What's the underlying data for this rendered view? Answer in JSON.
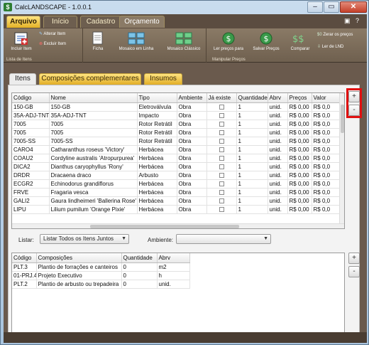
{
  "window": {
    "title": "CalcLANDSCAPE - 1.0.0.1",
    "app_icon": "$"
  },
  "ribbon_tabs": [
    "Arquivo",
    "Início",
    "Cadastro",
    "Orçamento"
  ],
  "ribbon": {
    "lista": {
      "incluir": "Incluir Item",
      "alterar": "Alterar Item",
      "excluir": "Excluir Item",
      "group_label": "Lista de Itens"
    },
    "ficha": "Ficha",
    "mosaico_linha": "Mosaico em Linha",
    "mosaico_classico": "Mosaico Clássico",
    "precos": {
      "ler_precos": "Ler preços para",
      "salvar_precos": "Salvar Preços",
      "comparar": "Comparar",
      "zerar": "Zerar os preços",
      "ler_lnd": "Ler de LND",
      "group_label": "Manipular Preços"
    }
  },
  "doc_tabs": [
    "Itens",
    "Composições complementares",
    "Insumos"
  ],
  "items_table": {
    "columns": [
      "Código",
      "Nome",
      "Tipo",
      "Ambiente",
      "Já existe",
      "Quantidade",
      "Abrv",
      "Preços",
      "Valor"
    ],
    "rows": [
      [
        "150-GB",
        "150-GB",
        "Eletroválvula",
        "Obra",
        "",
        "1",
        "unid.",
        "R$ 0,00",
        "R$ 0,0"
      ],
      [
        "35A-ADJ-TNT",
        "35A-ADJ-TNT",
        "Impacto",
        "Obra",
        "",
        "1",
        "unid.",
        "R$ 0,00",
        "R$ 0,0"
      ],
      [
        "7005",
        "7005",
        "Rotor Retrátil",
        "Obra",
        "",
        "1",
        "unid.",
        "R$ 0,00",
        "R$ 0,0"
      ],
      [
        "7005",
        "7005",
        "Rotor Retrátil",
        "Obra",
        "",
        "1",
        "unid.",
        "R$ 0,00",
        "R$ 0,0"
      ],
      [
        "7005-SS",
        "7005-SS",
        "Rotor Retrátil",
        "Obra",
        "",
        "1",
        "unid.",
        "R$ 0,00",
        "R$ 0,0"
      ],
      [
        "CARO4",
        "Catharanthus roseus 'Victory'",
        "Herbácea",
        "Obra",
        "",
        "1",
        "unid.",
        "R$ 0,00",
        "R$ 0,0"
      ],
      [
        "COAU2",
        "Cordyline australis 'Atropurpurea'",
        "Herbácea",
        "Obra",
        "",
        "1",
        "unid.",
        "R$ 0,00",
        "R$ 0,0"
      ],
      [
        "DICA2",
        "Dianthus caryophyllus 'Rony'",
        "Herbácea",
        "Obra",
        "",
        "1",
        "unid.",
        "R$ 0,00",
        "R$ 0,0"
      ],
      [
        "DRDR",
        "Dracaena draco",
        "Arbusto",
        "Obra",
        "",
        "1",
        "unid.",
        "R$ 0,00",
        "R$ 0,0"
      ],
      [
        "ECGR2",
        "Echinodorus grandiflorus",
        "Herbácea",
        "Obra",
        "",
        "1",
        "unid.",
        "R$ 0,00",
        "R$ 0,0"
      ],
      [
        "FRVE",
        "Fragaria vesca",
        "Herbácea",
        "Obra",
        "",
        "1",
        "unid.",
        "R$ 0,00",
        "R$ 0,0"
      ],
      [
        "GALI2",
        "Gaura lindheimeri 'Ballerina Rose'",
        "Herbácea",
        "Obra",
        "",
        "1",
        "unid.",
        "R$ 0,00",
        "R$ 0,0"
      ],
      [
        "LIPU",
        "Lilium pumilum 'Orange Pixie'",
        "Herbácea",
        "Obra",
        "",
        "1",
        "unid.",
        "R$ 0,00",
        "R$ 0,0"
      ]
    ]
  },
  "filters": {
    "listar_label": "Listar:",
    "listar_value": "Listar Todos os Itens Juntos",
    "ambiente_label": "Ambiente:",
    "ambiente_value": ""
  },
  "comp_table": {
    "columns": [
      "Código",
      "Composições",
      "Quantidade",
      "Abrv"
    ],
    "rows": [
      [
        "PLT.3",
        "Plantio de forrações e canteiros",
        "0",
        "m2"
      ],
      [
        "01-PRJ.4",
        "Projeto Executivo",
        "0",
        "h"
      ],
      [
        "PLT.2",
        "Plantio de arbusto ou trepadeira",
        "0",
        "unid."
      ]
    ]
  },
  "side_buttons": {
    "add": "+",
    "remove": "-"
  },
  "colors": {
    "accent_gold": "#e3b126",
    "brown": "#6a5a4d",
    "highlight": "#e01010"
  }
}
